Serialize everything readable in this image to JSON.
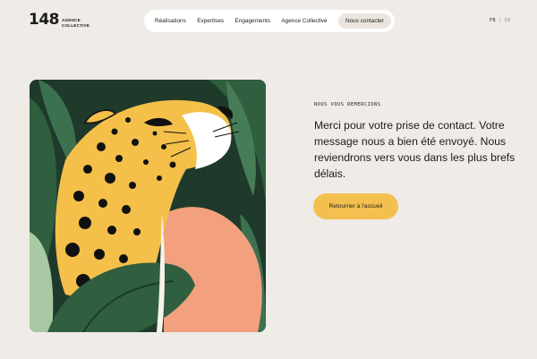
{
  "brand": {
    "logo_mark": "148",
    "logo_line1": "AGENCE",
    "logo_line2": "COLLECTIVE"
  },
  "nav": {
    "items": [
      {
        "label": "Réalisations"
      },
      {
        "label": "Expertises"
      },
      {
        "label": "Engagements"
      },
      {
        "label": "Agence Collective"
      },
      {
        "label": "Nous contacter"
      }
    ],
    "active_index": 4
  },
  "language": {
    "current": "FR",
    "separator": "|",
    "other": "EN"
  },
  "content": {
    "eyebrow": "NOUS VOUS REMERCIONS",
    "message": "Merci pour votre prise de contact. Votre message nous a bien été envoyé. Nous reviendrons vers vous dans les plus brefs délais.",
    "cta_label": "Retourner à l'accueil"
  },
  "illustration": {
    "subject": "leopard-in-jungle-icon"
  },
  "colors": {
    "background": "#efebe6",
    "accent": "#f3c04f",
    "jungle_dark": "#1f3a2b",
    "leaf_green": "#2f5f3f",
    "peach": "#f2a07e",
    "leopard_yellow": "#f4c04a"
  }
}
